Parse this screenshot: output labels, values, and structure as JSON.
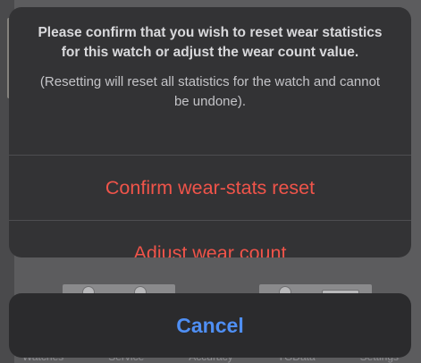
{
  "dialog": {
    "message": "Please confirm that you wish to reset wear statistics for this watch or adjust the wear count value.",
    "note": "(Resetting will reset all statistics for the watch and cannot be undone).",
    "confirm_label": "Confirm wear-stats reset",
    "adjust_label": "Adjust wear count",
    "cancel_label": "Cancel"
  },
  "tabbar": {
    "tabs": [
      "Watches",
      "Service",
      "Accuracy",
      "TGData",
      "Settings"
    ]
  },
  "colors": {
    "destructive": "#f0544a",
    "cancel": "#4f8ff4",
    "sheet_bg": "#333335"
  }
}
